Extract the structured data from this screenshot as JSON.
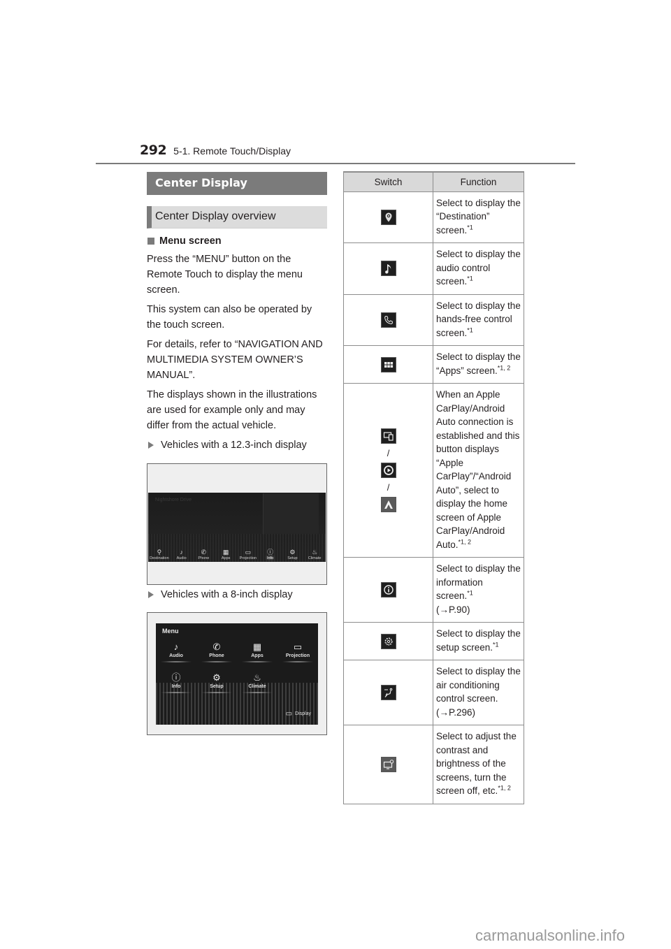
{
  "header": {
    "page_number": "292",
    "section": "5-1. Remote Touch/Display"
  },
  "left": {
    "title": "Center Display",
    "subtitle": "Center Display overview",
    "subsection": "Menu screen",
    "paragraphs": [
      "Press the “MENU” button on the Remote Touch to display the menu screen.",
      "This system can also be operated by the touch screen.",
      "For details, refer to “NAVIGATION AND MULTIMEDIA SYSTEM OWNER’S MANUAL”.",
      "The displays shown in the illustrations are used for example only and may differ from the actual vehicle."
    ],
    "variant_12": "Vehicles with a 12.3-inch display",
    "variant_8": "Vehicles with a 8-inch display"
  },
  "screen12": {
    "bg_title": "Nightshore Drive",
    "items": [
      {
        "icon": "destination-icon",
        "glyph": "⚲",
        "label": "Destination"
      },
      {
        "icon": "audio-icon",
        "glyph": "♪",
        "label": "Audio"
      },
      {
        "icon": "phone-icon",
        "glyph": "✆",
        "label": "Phone"
      },
      {
        "icon": "apps-icon",
        "glyph": "▦",
        "label": "Apps"
      },
      {
        "icon": "projection-icon",
        "glyph": "▭",
        "label": "Projection"
      },
      {
        "icon": "info-icon",
        "glyph": "ⓘ",
        "label": "Info"
      },
      {
        "icon": "setup-icon",
        "glyph": "⚙",
        "label": "Setup"
      },
      {
        "icon": "climate-icon",
        "glyph": "♨",
        "label": "Climate"
      }
    ]
  },
  "screen8": {
    "title": "Menu",
    "items": [
      {
        "icon": "audio-icon",
        "glyph": "♪",
        "label": "Audio"
      },
      {
        "icon": "phone-icon",
        "glyph": "✆",
        "label": "Phone"
      },
      {
        "icon": "apps-icon",
        "glyph": "▦",
        "label": "Apps"
      },
      {
        "icon": "projection-icon",
        "glyph": "▭",
        "label": "Projection"
      },
      {
        "icon": "info-icon",
        "glyph": "ⓘ",
        "label": "Info"
      },
      {
        "icon": "setup-icon",
        "glyph": "⚙",
        "label": "Setup"
      },
      {
        "icon": "climate-icon",
        "glyph": "♨",
        "label": "Climate"
      }
    ],
    "display_button": {
      "icon": "display-icon",
      "glyph": "▭",
      "label": "Display"
    }
  },
  "table": {
    "headers": {
      "switch": "Switch",
      "function": "Function"
    },
    "rows": [
      {
        "icons": [
          "destination-icon"
        ],
        "text": "Select to display the “Destination” screen.",
        "note": "*1"
      },
      {
        "icons": [
          "audio-icon"
        ],
        "text": "Select to display the audio control screen.",
        "note": "*1"
      },
      {
        "icons": [
          "phone-icon"
        ],
        "text": "Select to display the hands-free control screen.",
        "note": "*1"
      },
      {
        "icons": [
          "apps-icon"
        ],
        "text": "Select to display the “Apps” screen.",
        "note": "*1, 2"
      },
      {
        "icons": [
          "projection-icon",
          "apple-carplay-icon",
          "android-auto-icon"
        ],
        "separator": "/",
        "text": "When an Apple CarPlay/Android Auto connection is established and this button displays “Apple CarPlay”/“Android Auto”, select to display the home screen of Apple CarPlay/Android Auto.",
        "note": "*1, 2"
      },
      {
        "icons": [
          "info-icon"
        ],
        "text": "Select to display the information screen.",
        "note": "*1",
        "ref": "(→P.90)"
      },
      {
        "icons": [
          "setup-icon"
        ],
        "text": "Select to display the setup screen.",
        "note": "*1"
      },
      {
        "icons": [
          "climate-icon"
        ],
        "text": "Select to display the air conditioning control screen.",
        "ref": "(→P.296)"
      },
      {
        "icons": [
          "display-icon"
        ],
        "text": "Select to adjust the contrast and brightness of the screens, turn the screen off, etc.",
        "note": "*1, 2"
      }
    ]
  },
  "watermark": "carmanualsonline.info"
}
